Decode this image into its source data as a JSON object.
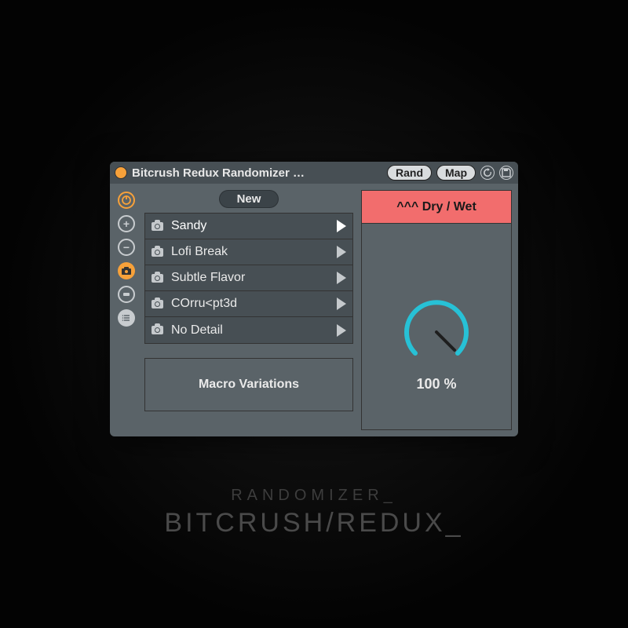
{
  "titlebar": {
    "title": "Bitcrush Redux Randomizer …",
    "rand_label": "Rand",
    "map_label": "Map"
  },
  "presets": {
    "new_label": "New",
    "items": [
      {
        "label": "Sandy",
        "selected": true
      },
      {
        "label": "Lofi Break",
        "selected": false
      },
      {
        "label": "Subtle Flavor",
        "selected": false
      },
      {
        "label": "COrru<pt3d",
        "selected": false
      },
      {
        "label": "No Detail",
        "selected": false
      }
    ],
    "footer_label": "Macro Variations"
  },
  "knob": {
    "header": "^^^ Dry / Wet",
    "value_text": "100 %",
    "value_pct": 100,
    "colors": {
      "accent": "#27c1d6",
      "header_bg": "#f26d6d"
    }
  },
  "caption": {
    "line1": "RANDOMIZER_",
    "line2": "BITCRUSH/REDUX_"
  }
}
